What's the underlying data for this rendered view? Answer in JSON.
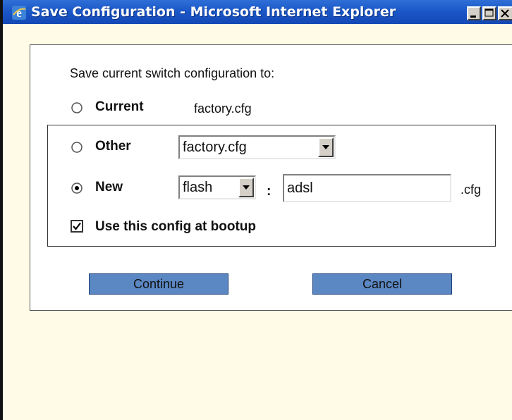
{
  "window": {
    "title": "Save Configuration - Microsoft Internet Explorer",
    "controls": {
      "minimize": "minimize",
      "maximize": "maximize",
      "close": "close"
    },
    "icon": "ie-icon"
  },
  "form": {
    "prompt": "Save current switch configuration to:",
    "options": [
      {
        "label": "Current",
        "selected": false
      },
      {
        "label": "Other",
        "selected": false
      },
      {
        "label": "New",
        "selected": true
      }
    ],
    "current_file": "factory.cfg",
    "other_select": {
      "value": "factory.cfg",
      "options": [
        "factory.cfg"
      ]
    },
    "new_location_select": {
      "value": "flash",
      "options": [
        "flash"
      ]
    },
    "colon": ":",
    "new_filename": "adsl",
    "extension": ".cfg",
    "bootup_checkbox": {
      "label": "Use this config at bootup",
      "checked": true
    }
  },
  "buttons": {
    "continue": "Continue",
    "cancel": "Cancel"
  },
  "colors": {
    "titlebar": "#1b57c8",
    "window_background": "#fffbe6",
    "button_fill": "#5b87c2"
  }
}
